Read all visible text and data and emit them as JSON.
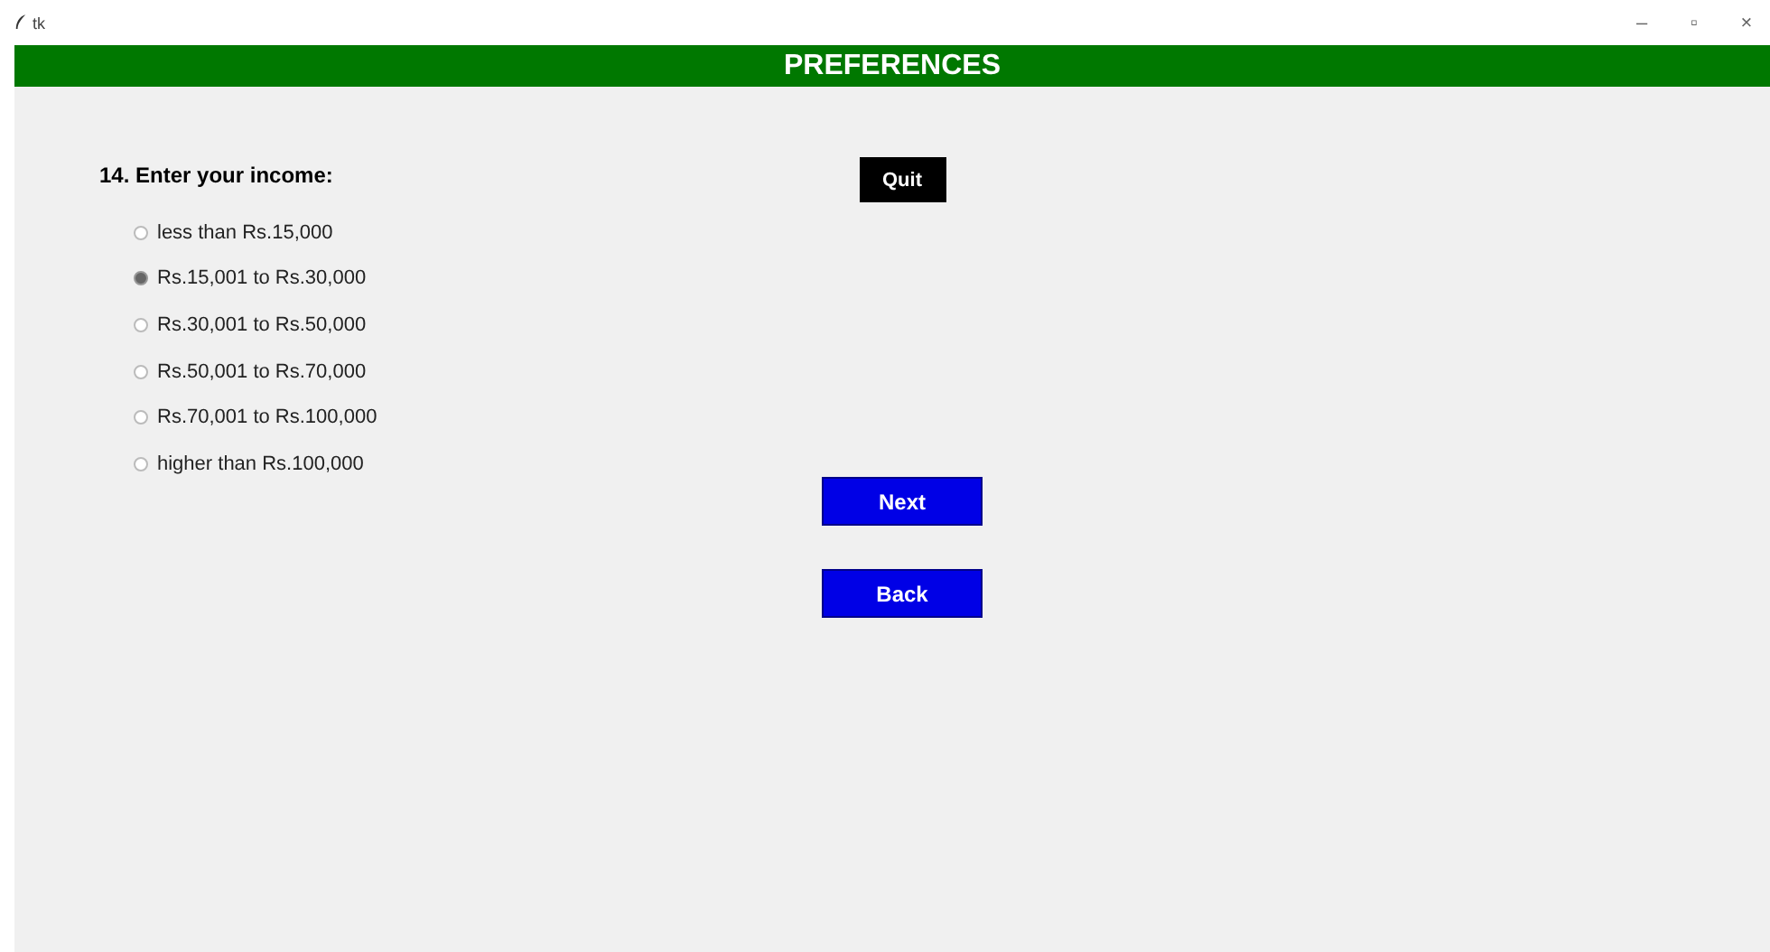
{
  "window": {
    "title": "tk",
    "controls": [
      "–",
      "▫",
      "×"
    ]
  },
  "header": {
    "title": "PREFERENCES"
  },
  "question": "14. Enter your income:",
  "options": [
    {
      "label": "less than Rs.15,000",
      "selected": false
    },
    {
      "label": "Rs.15,001 to Rs.30,000",
      "selected": true
    },
    {
      "label": "Rs.30,001 to Rs.50,000",
      "selected": false
    },
    {
      "label": "Rs.50,001 to Rs.70,000",
      "selected": false
    },
    {
      "label": "Rs.70,001 to Rs.100,000",
      "selected": false
    },
    {
      "label": "higher than Rs.100,000",
      "selected": false
    }
  ],
  "buttons": [
    {
      "label": "Quit",
      "kind": "quit"
    },
    {
      "label": "Next",
      "kind": "nav"
    },
    {
      "label": "Back",
      "kind": "nav"
    }
  ]
}
